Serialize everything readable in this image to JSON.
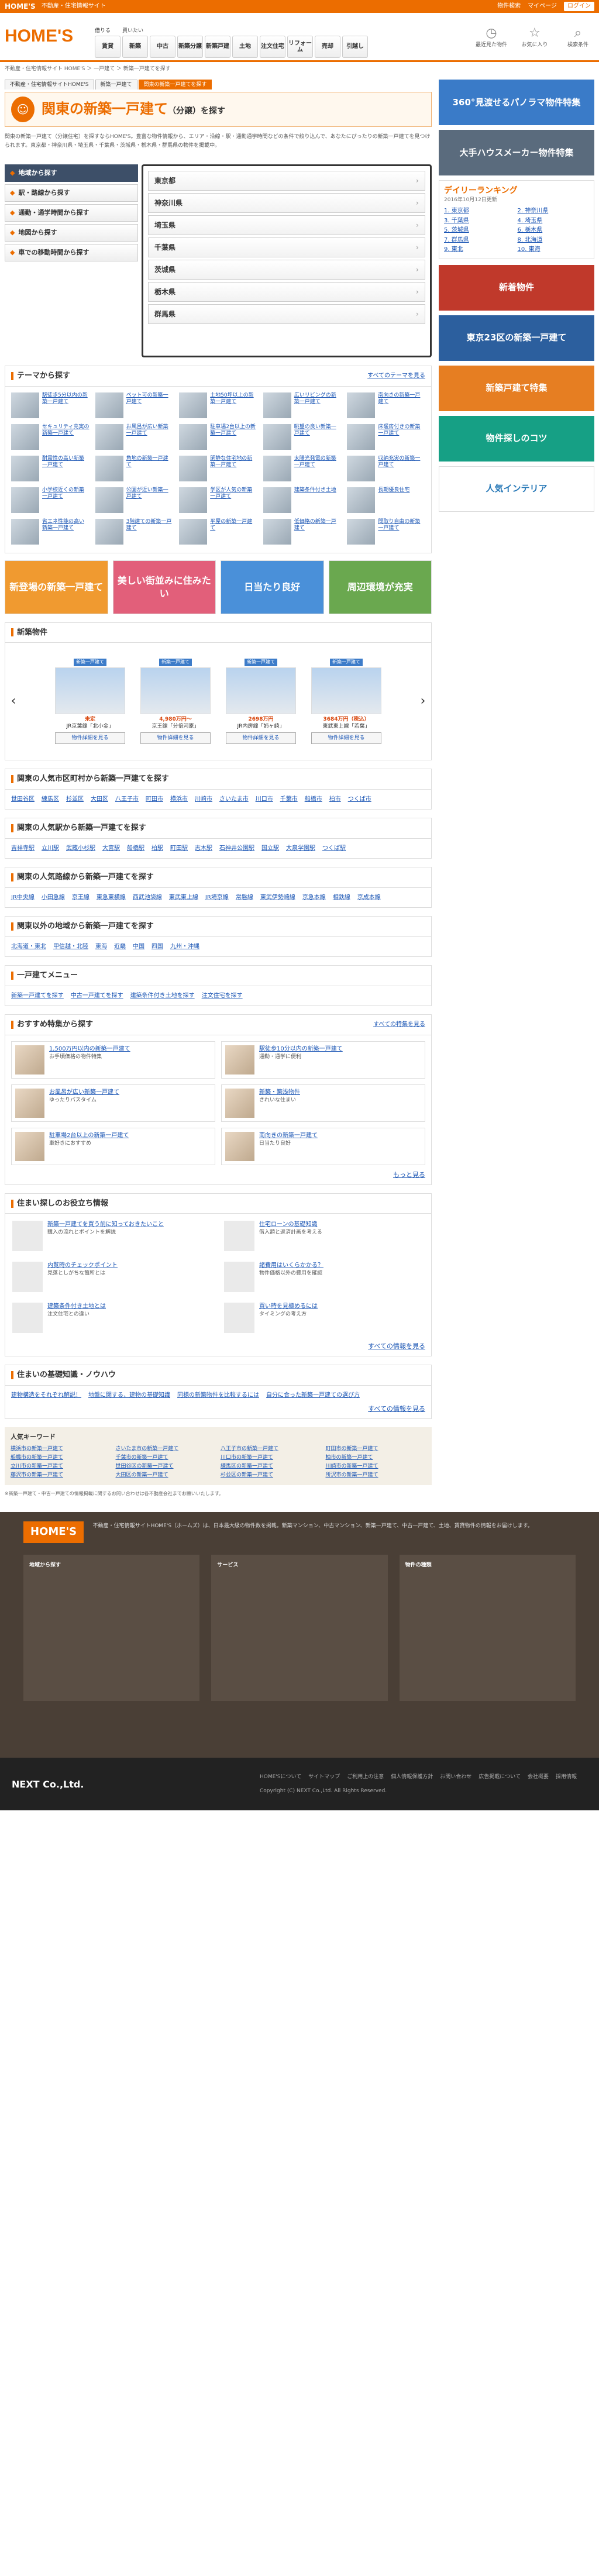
{
  "topbar": {
    "brand": "HOME'S",
    "tagline": "不動産・住宅情報サイト",
    "links": [
      "物件検索",
      "マイページ",
      "ログイン"
    ]
  },
  "header": {
    "logo": "HOME'S",
    "buy_label": "買いたい",
    "rent_label": "借りる",
    "nav": [
      "賃貸",
      "新築",
      "中古",
      "新築分譲",
      "新築戸建",
      "土地",
      "注文住宅",
      "リフォーム",
      "売却",
      "引越し"
    ],
    "icons": [
      "最近見た物件",
      "お気に入り",
      "検索条件"
    ]
  },
  "breadcrumb": "不動産・住宅情報サイト HOME'S ＞ 一戸建て ＞ 新築一戸建てを探す",
  "tabs": [
    "不動産・住宅情報サイトHOME'S",
    "新築一戸建て",
    "関東の新築一戸建てを探す"
  ],
  "title": {
    "main": "関東の新築一戸建て",
    "sub": "（分譲）を探す"
  },
  "intro": "関東の新築一戸建て（分譲住宅）を探すならHOME'S。豊富な物件情報から、エリア・沿線・駅・通勤通学時間などの条件で絞り込んで、あなたにぴったりの新築一戸建てを見つけられます。東京都・神奈川県・埼玉県・千葉県・茨城県・栃木県・群馬県の物件を掲載中。",
  "search": {
    "menu": [
      "地域から探す",
      "駅・路線から探す",
      "通勤・通学時間から探す",
      "地図から探す",
      "車での移動時間から探す"
    ],
    "prefectures": [
      "東京都",
      "神奈川県",
      "埼玉県",
      "千葉県",
      "茨城県",
      "栃木県",
      "群馬県"
    ]
  },
  "themes": {
    "title": "テーマから探す",
    "more": "すべてのテーマを見る",
    "items": [
      "駅徒歩5分以内の新築一戸建て",
      "ペット可の新築一戸建て",
      "土地50坪以上の新築一戸建て",
      "広いリビングの新築一戸建て",
      "南向きの新築一戸建て",
      "セキュリティ充実の新築一戸建て",
      "お風呂が広い新築一戸建て",
      "駐車場2台以上の新築一戸建て",
      "眺望の良い新築一戸建て",
      "床暖房付きの新築一戸建て",
      "耐震性の高い新築一戸建て",
      "角地の新築一戸建て",
      "閑静な住宅地の新築一戸建て",
      "太陽光発電の新築一戸建て",
      "収納充実の新築一戸建て",
      "小学校近くの新築一戸建て",
      "公園が近い新築一戸建て",
      "学区が人気の新築一戸建て",
      "建築条件付き土地",
      "長期優良住宅",
      "省エネ性能の高い新築一戸建て",
      "3階建ての新築一戸建て",
      "平屋の新築一戸建て",
      "低価格の新築一戸建て",
      "間取り自由の新築一戸建て"
    ]
  },
  "banners": [
    "新登場の新築一戸建て",
    "美しい街並みに住みたい",
    "日当たり良好",
    "周辺環境が充実"
  ],
  "new": {
    "title": "新築物件",
    "items": [
      {
        "tag": "新築一戸建て",
        "price": "未定",
        "name": "JR京葉線「北小金」"
      },
      {
        "tag": "新築一戸建て",
        "price": "4,980万円～",
        "name": "京王線「分倍河原」"
      },
      {
        "tag": "新築一戸建て",
        "price": "2698万円",
        "name": "JR内房線「姉ヶ崎」"
      },
      {
        "tag": "新築一戸建て",
        "price": "3684万円（税込）",
        "name": "東武東上線「若葉」"
      }
    ],
    "btn": "物件詳細を見る"
  },
  "areas": [
    {
      "title": "関東の人気市区町村から新築一戸建てを探す",
      "links": [
        "世田谷区",
        "練馬区",
        "杉並区",
        "大田区",
        "八王子市",
        "町田市",
        "横浜市",
        "川崎市",
        "さいたま市",
        "川口市",
        "千葉市",
        "船橋市",
        "柏市",
        "つくば市"
      ]
    },
    {
      "title": "関東の人気駅から新築一戸建てを探す",
      "links": [
        "吉祥寺駅",
        "立川駅",
        "武蔵小杉駅",
        "大宮駅",
        "船橋駅",
        "柏駅",
        "町田駅",
        "志木駅",
        "石神井公園駅",
        "国立駅",
        "大泉学園駅",
        "つくば駅"
      ]
    },
    {
      "title": "関東の人気路線から新築一戸建てを探す",
      "links": [
        "JR中央線",
        "小田急線",
        "京王線",
        "東急東横線",
        "西武池袋線",
        "東武東上線",
        "JR埼京線",
        "常磐線",
        "東武伊勢崎線",
        "京急本線",
        "相鉄線",
        "京成本線"
      ]
    },
    {
      "title": "関東以外の地域から新築一戸建てを探す",
      "links": [
        "北海道・東北",
        "甲信越・北陸",
        "東海",
        "近畿",
        "中国",
        "四国",
        "九州・沖縄"
      ]
    }
  ],
  "other": {
    "title": "一戸建てメニュー",
    "links": [
      "新築一戸建てを探す",
      "中古一戸建てを探す",
      "建築条件付き土地を探す",
      "注文住宅を探す"
    ]
  },
  "featured": {
    "title": "おすすめ特集から探す",
    "more": "すべての特集を見る",
    "items": [
      {
        "t": "1,500万円以内の新築一戸建て",
        "d": "お手頃価格の物件特集"
      },
      {
        "t": "駅徒歩10分以内の新築一戸建て",
        "d": "通勤・通学に便利"
      },
      {
        "t": "お風呂が広い新築一戸建て",
        "d": "ゆったりバスタイム"
      },
      {
        "t": "新築・築浅物件",
        "d": "きれいな住まい"
      },
      {
        "t": "駐車場2台以上の新築一戸建て",
        "d": "車好きにおすすめ"
      },
      {
        "t": "南向きの新築一戸建て",
        "d": "日当たり良好"
      }
    ],
    "more2": "もっと見る"
  },
  "tips": {
    "title": "住まい探しのお役立ち情報",
    "more": "すべての情報を見る",
    "items": [
      {
        "t": "新築一戸建てを買う前に知っておきたいこと",
        "d": "購入の流れとポイントを解説"
      },
      {
        "t": "住宅ローンの基礎知識",
        "d": "借入額と返済計画を考える"
      },
      {
        "t": "内覧時のチェックポイント",
        "d": "見落としがちな箇所とは"
      },
      {
        "t": "諸費用はいくらかかる？",
        "d": "物件価格以外の費用を確認"
      },
      {
        "t": "建築条件付き土地とは",
        "d": "注文住宅との違い"
      },
      {
        "t": "買い時を見極めるには",
        "d": "タイミングの考え方"
      }
    ]
  },
  "basics": {
    "title": "住まいの基礎知識・ノウハウ",
    "links": [
      "建物構造をそれぞれ解説！",
      "地盤に関する、建物の基礎知識",
      "同様の新築物件を比較するには",
      "自分に合った新築一戸建ての選び方"
    ],
    "more": "すべての情報を見る"
  },
  "keywords": {
    "title": "人気キーワード",
    "items": [
      "横浜市の新築一戸建て",
      "さいたま市の新築一戸建て",
      "八王子市の新築一戸建て",
      "町田市の新築一戸建て",
      "船橋市の新築一戸建て",
      "千葉市の新築一戸建て",
      "川口市の新築一戸建て",
      "柏市の新築一戸建て",
      "立川市の新築一戸建て",
      "世田谷区の新築一戸建て",
      "練馬区の新築一戸建て",
      "川崎市の新築一戸建て",
      "藤沢市の新築一戸建て",
      "大田区の新築一戸建て",
      "杉並区の新築一戸建て",
      "所沢市の新築一戸建て"
    ]
  },
  "note": "※新築一戸建て・中古一戸建ての情報掲載に関するお問い合わせは各不動産会社までお願いいたします。",
  "side": {
    "banners": [
      "360°見渡せるパノラマ物件特集",
      "大手ハウスメーカー物件特集"
    ],
    "rank": {
      "title": "デイリーランキング",
      "date": "2016年10月12日更新",
      "items": [
        "東京都",
        "神奈川県",
        "千葉県",
        "埼玉県",
        "茨城県",
        "栃木県",
        "群馬県",
        "北海道",
        "東北",
        "東海"
      ]
    },
    "banners2": [
      "新着物件",
      "東京23区の新築一戸建て",
      "新築戸建て特集",
      "物件探しのコツ"
    ],
    "interior": "人気インテリア"
  },
  "footer": {
    "logo": "HOME'S",
    "text": "不動産・住宅情報サイトHOME'S（ホームズ）は、日本最大級の物件数を掲載。新築マンション、中古マンション、新築一戸建て、中古一戸建て、土地、賃貸物件の情報をお届けします。",
    "col1": "地域から探す",
    "col2": "サービス",
    "col3": "物件の種類"
  },
  "bottom": {
    "brand": "NEXT Co.,Ltd.",
    "links": [
      "HOME'Sについて",
      "サイトマップ",
      "ご利用上の注意",
      "個人情報保護方針",
      "お問い合わせ",
      "広告掲載について",
      "会社概要",
      "採用情報"
    ],
    "copy": "Copyright (C) NEXT Co.,Ltd. All Rights Reserved."
  }
}
